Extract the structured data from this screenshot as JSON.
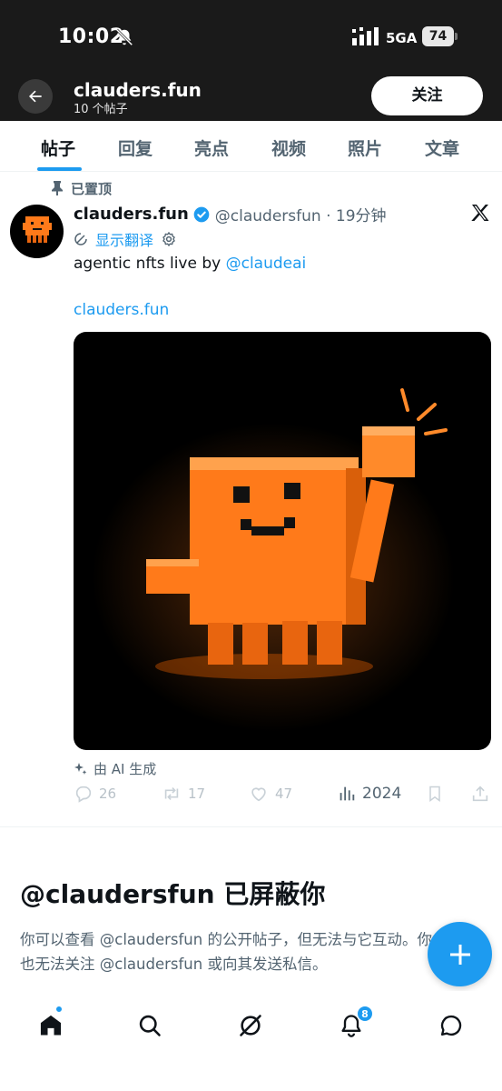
{
  "status_bar": {
    "time": "10:02",
    "network": "5GA",
    "battery": "74"
  },
  "header": {
    "profile_name": "clauders.fun",
    "post_count": "10 个帖子",
    "follow_label": "关注"
  },
  "tabs": [
    {
      "label": "帖子",
      "active": true
    },
    {
      "label": "回复",
      "active": false
    },
    {
      "label": "亮点",
      "active": false
    },
    {
      "label": "视频",
      "active": false
    },
    {
      "label": "照片",
      "active": false
    },
    {
      "label": "文章",
      "active": false
    }
  ],
  "post": {
    "pinned_label": "已置顶",
    "author_name": "clauders.fun",
    "handle_time": "@claudersfun · 19分钟",
    "translate_label": "显示翻译",
    "text_prefix": "agentic nfts live by ",
    "mention": "@claudeai",
    "link": "clauders.fun",
    "ai_label": "由 AI 生成",
    "stats": {
      "replies": "26",
      "reposts": "17",
      "likes": "47",
      "views": "2024"
    }
  },
  "blocked": {
    "title": "@claudersfun 已屏蔽你",
    "description": "你可以查看 @claudersfun 的公开帖子，但无法与它互动。你也无法关注 @claudersfun 或向其发送私信。"
  },
  "bottom_nav": {
    "notifications_badge": "8"
  },
  "colors": {
    "accent": "#1d9bf0",
    "header_bg": "#1a1a1a",
    "mascot": "#ff7a1a"
  },
  "icons": [
    "bell-muted-icon",
    "signal-icon",
    "battery-icon",
    "back-arrow-icon",
    "pin-icon",
    "verified-badge-icon",
    "x-logo-icon",
    "translate-icon",
    "gear-icon",
    "sparkle-icon",
    "reply-icon",
    "repost-icon",
    "like-icon",
    "views-icon",
    "bookmark-icon",
    "share-icon",
    "plus-icon",
    "home-icon",
    "search-icon",
    "grok-icon",
    "notifications-icon",
    "messages-icon"
  ]
}
